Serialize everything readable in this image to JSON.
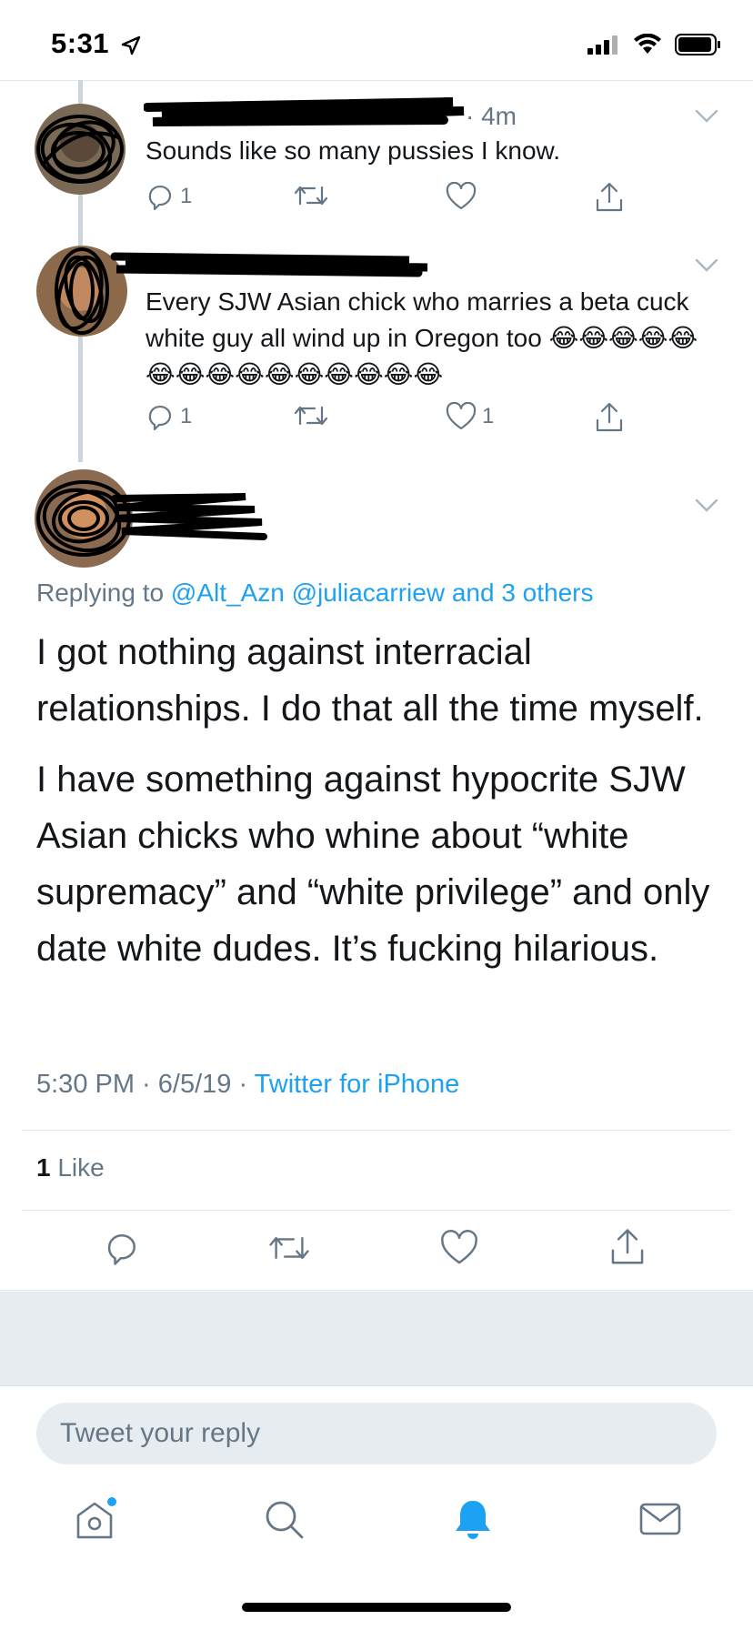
{
  "status_bar": {
    "time": "5:31"
  },
  "thread": [
    {
      "meta_time": "· 4m",
      "text": "Sounds like so many pussies I know.",
      "reply_count": "1",
      "retweet_count": "",
      "like_count": ""
    },
    {
      "meta_time": "",
      "text": "Every SJW Asian chick who marries a beta cuck white guy all wind up in Oregon too 😂😂😂😂😂😂😂😂😂😂😂😂😂😂😂",
      "reply_count": "1",
      "retweet_count": "",
      "like_count": "1"
    }
  ],
  "main_tweet": {
    "replying_prefix": "Replying to ",
    "replying_to": "@Alt_Azn @juliacarriew and 3 others",
    "paragraph_1": "I got nothing against interracial relationships. I do that all the time myself.",
    "paragraph_2": "I have something against hypocrite SJW Asian chicks who whine about “white supremacy” and “white privilege” and only date white dudes. It’s fucking hilarious.",
    "timestamp": "5:30 PM · 6/5/19 · ",
    "source": "Twitter for iPhone",
    "like_count": "1",
    "like_label": " Like"
  },
  "reply_box": {
    "placeholder": "Tweet your reply"
  },
  "tabbar": {
    "items": [
      "home",
      "search",
      "notifications",
      "messages"
    ],
    "active": "notifications"
  },
  "colors": {
    "accent": "#1da1f2",
    "secondary_text": "#657786",
    "divider": "#e1e8ed",
    "background_gray": "#e6ecf0"
  }
}
